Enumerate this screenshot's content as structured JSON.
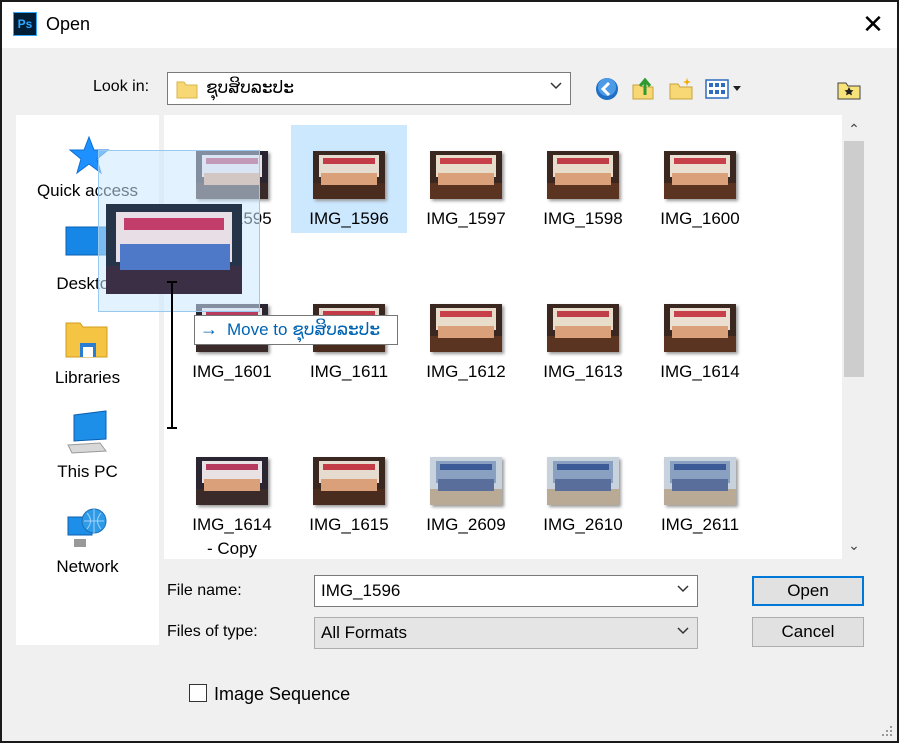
{
  "window": {
    "title": "Open",
    "app_icon_text": "Ps"
  },
  "toolbar": {
    "look_in_label": "Look in:",
    "look_in_value": "ຊຸບສິບລະປະ"
  },
  "sidebar": {
    "items": [
      {
        "label": "Quick access",
        "icon": "star-icon"
      },
      {
        "label": "Desktop",
        "icon": "desktop-icon"
      },
      {
        "label": "Libraries",
        "icon": "libraries-icon"
      },
      {
        "label": "This PC",
        "icon": "computer-icon"
      },
      {
        "label": "Network",
        "icon": "network-icon"
      }
    ]
  },
  "files": [
    {
      "name": "IMG_1595"
    },
    {
      "name": "IMG_1596"
    },
    {
      "name": "IMG_1597"
    },
    {
      "name": "IMG_1598"
    },
    {
      "name": "IMG_1600"
    },
    {
      "name": "IMG_1601"
    },
    {
      "name": "IMG_1611"
    },
    {
      "name": "IMG_1612"
    },
    {
      "name": "IMG_1613"
    },
    {
      "name": "IMG_1614"
    },
    {
      "name": "IMG_1614 - Copy"
    },
    {
      "name": "IMG_1615"
    },
    {
      "name": "IMG_2609"
    },
    {
      "name": "IMG_2610"
    },
    {
      "name": "IMG_2611"
    }
  ],
  "selected_file": "IMG_1596",
  "drag_tooltip": {
    "arrow": "→",
    "text": "Move to ຊຸບສິບລະປະ"
  },
  "form": {
    "file_name_label": "File name:",
    "file_name_value": "IMG_1596",
    "files_of_type_label": "Files of type:",
    "files_of_type_value": "All Formats",
    "open_button": "Open",
    "cancel_button": "Cancel",
    "image_sequence_label": "Image Sequence",
    "image_sequence_checked": false
  },
  "colors": {
    "accent": "#0078d7",
    "selection": "#cce8ff",
    "ps_blue": "#31a8ff"
  }
}
